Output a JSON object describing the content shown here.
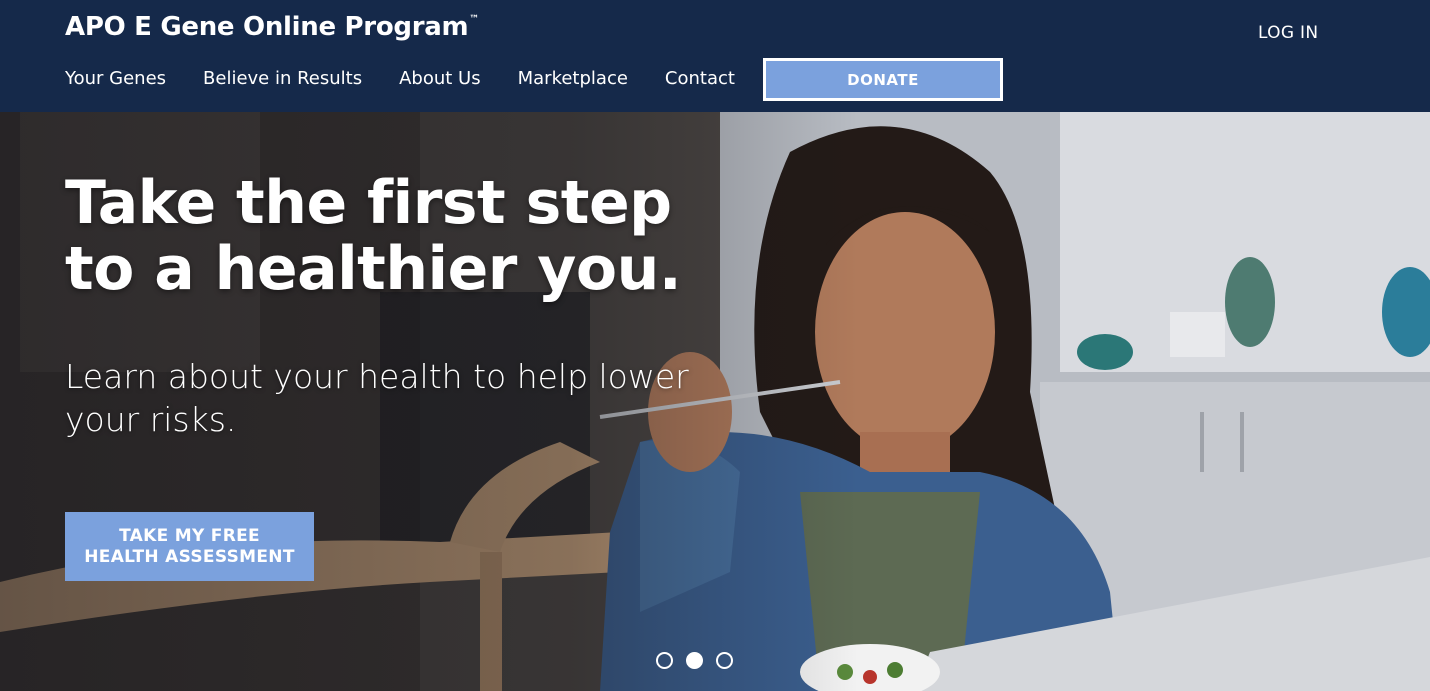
{
  "header": {
    "brand": "APO E Gene Online Program",
    "trademark": "™",
    "login_label": "LOG IN",
    "nav": [
      {
        "label": "Your Genes"
      },
      {
        "label": "Believe in Results"
      },
      {
        "label": "About Us"
      },
      {
        "label": "Marketplace"
      },
      {
        "label": "Contact"
      }
    ],
    "donate_label": "DONATE"
  },
  "hero": {
    "headline_line1": "Take the first step",
    "headline_line2": "to a healthier you.",
    "subhead": "Learn about your health to help lower your risks.",
    "cta_line1": "TAKE MY FREE",
    "cta_line2": "HEALTH ASSESSMENT",
    "carousel": {
      "count": 3,
      "active_index": 1
    }
  },
  "colors": {
    "header_bg": "#15294a",
    "accent": "#7ba1dd"
  }
}
